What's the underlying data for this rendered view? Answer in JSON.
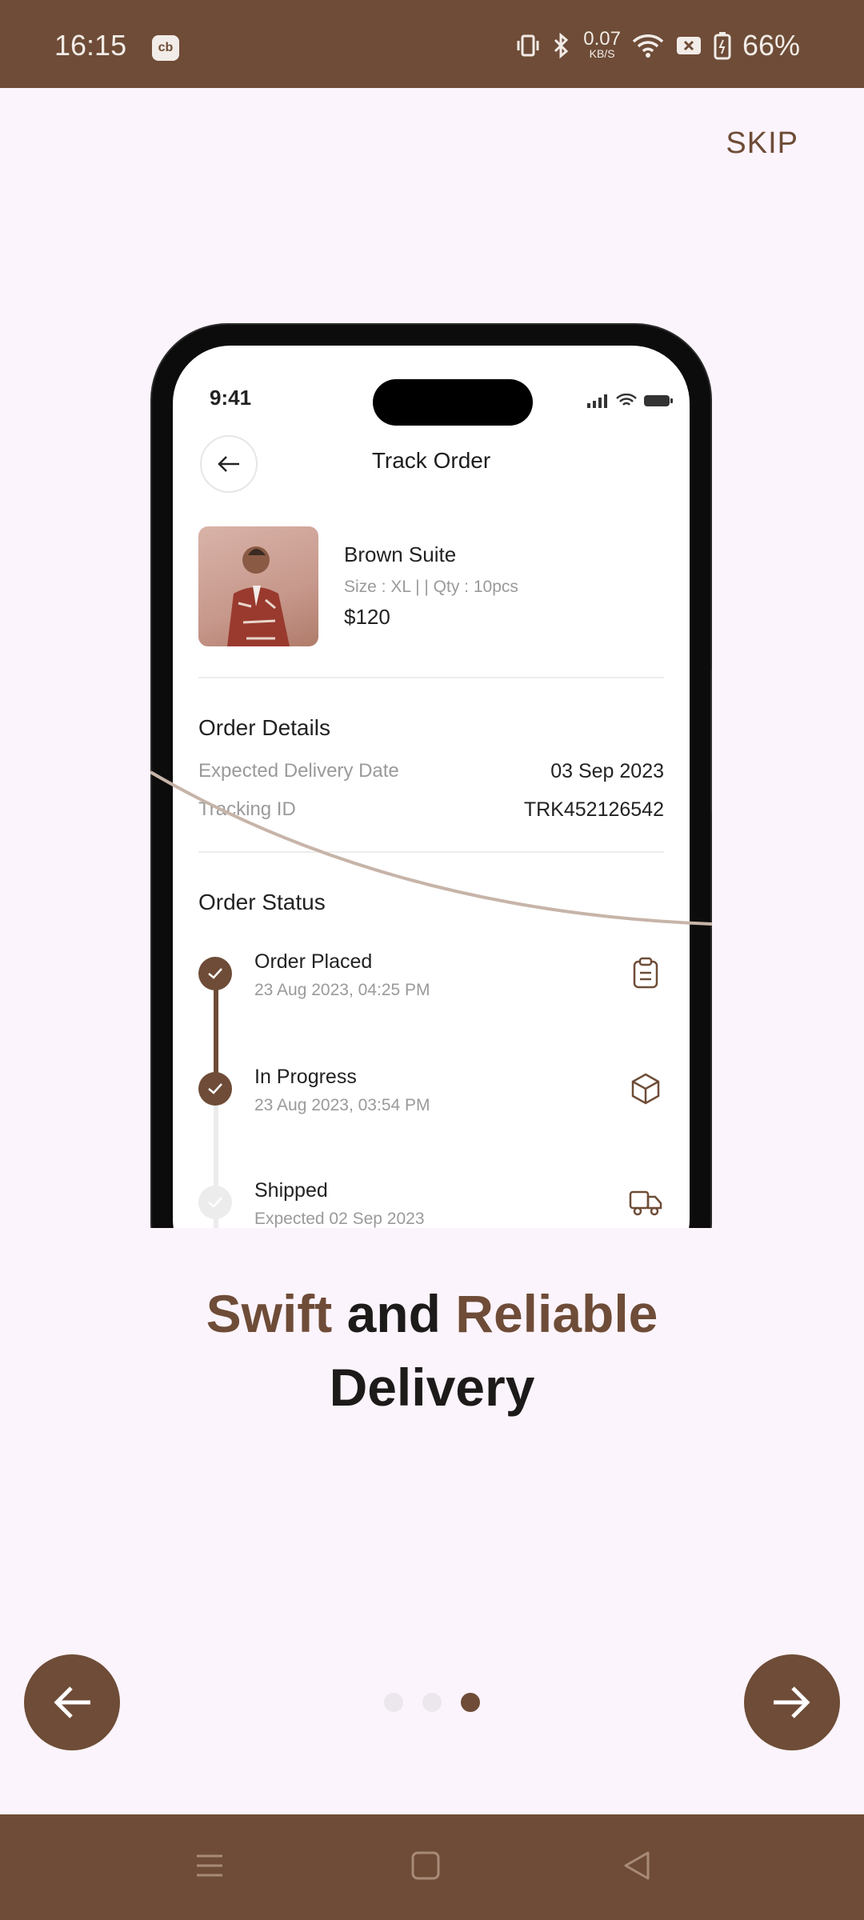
{
  "status_bar": {
    "time": "16:15",
    "app_icon_label": "cb",
    "net_speed_value": "0.07",
    "net_speed_unit": "KB/S",
    "battery": "66%",
    "icons": [
      "vibrate-icon",
      "bluetooth-icon",
      "wifi-icon",
      "sim-icon",
      "battery-icon"
    ]
  },
  "skip_label": "SKIP",
  "mockup": {
    "time": "9:41",
    "title": "Track Order",
    "product": {
      "name": "Brown Suite",
      "meta": "Size : XL | | Qty : 10pcs",
      "price": "$120"
    },
    "order_details": {
      "heading": "Order Details",
      "rows": [
        {
          "label": "Expected Delivery Date",
          "value": "03 Sep 2023"
        },
        {
          "label": "Tracking ID",
          "value": "TRK452126542"
        }
      ]
    },
    "order_status": {
      "heading": "Order Status",
      "steps": [
        {
          "title": "Order Placed",
          "sub": "23 Aug 2023, 04:25 PM",
          "done": true,
          "icon": "clipboard-icon"
        },
        {
          "title": "In Progress",
          "sub": "23 Aug 2023, 03:54 PM",
          "done": true,
          "icon": "box-icon"
        },
        {
          "title": "Shipped",
          "sub": "Expected 02 Sep 2023",
          "done": false,
          "icon": "truck-icon"
        }
      ]
    }
  },
  "headline": {
    "word1": "Swift",
    "word2": " and ",
    "word3": "Reliable",
    "word4": "Delivery"
  },
  "pagination": {
    "total": 3,
    "active_index": 2
  },
  "colors": {
    "brand": "#6e4c37",
    "background": "#fcf4fc"
  }
}
